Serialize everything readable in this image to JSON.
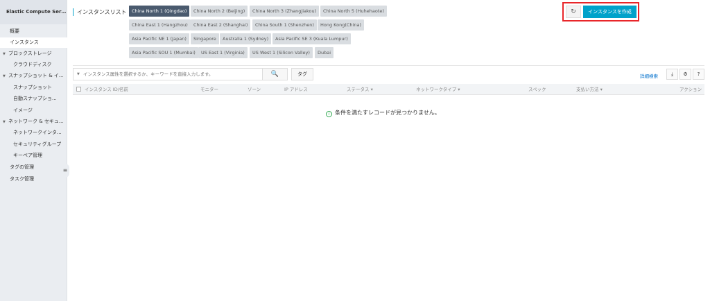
{
  "sidebar": {
    "title": "Elastic Compute Serv...",
    "items": [
      {
        "label": "概要",
        "tri": ""
      },
      {
        "label": "インスタンス",
        "tri": ""
      },
      {
        "label": "ブロックストレージ",
        "tri": "▼"
      },
      {
        "label": "クラウドディスク",
        "tri": ""
      },
      {
        "label": "スナップショット & イ...",
        "tri": "▼"
      },
      {
        "label": "スナップショット",
        "tri": ""
      },
      {
        "label": "自動スナップショ...",
        "tri": ""
      },
      {
        "label": "イメージ",
        "tri": ""
      },
      {
        "label": "ネットワーク & セキュ...",
        "tri": "▼"
      },
      {
        "label": "ネットワークインタ...",
        "tri": ""
      },
      {
        "label": "セキュリティグループ",
        "tri": ""
      },
      {
        "label": "キーペア管理",
        "tri": ""
      },
      {
        "label": "タグの管理",
        "tri": ""
      },
      {
        "label": "タスク管理",
        "tri": ""
      }
    ],
    "collapse_icon": "≡"
  },
  "header": {
    "list_title": "インスタンスリスト",
    "refresh_icon": "↻",
    "create_label": "インスタンスを作成"
  },
  "regions": [
    "China North 1 (Qingdao)",
    "China North 2 (Beijing)",
    "China North 3 (Zhangjiakou)",
    "China North 5 (Huhehaote)",
    "China East 1 (Hangzhou)",
    "China East 2 (Shanghai)",
    "China South 1 (Shenzhen)",
    "Hong Kong(China)",
    "Asia Pacific NE 1 (Japan)",
    "Singapore",
    "Australia 1 (Sydney)",
    "Asia Pacific SE 3 (Kuala Lumpur)",
    "Asia Pacific SOU 1 (Mumbai)",
    "US East 1 (Virginia)",
    "US West 1 (Silicon Valley)",
    "Dubai"
  ],
  "active_region": "China North 1 (Qingdao)",
  "search": {
    "placeholder": "インスタンス属性を選択するか、キーワードを直接入力します。",
    "caret": "▼",
    "search_icon": "🔍",
    "tag_label": "タグ"
  },
  "toolbar": {
    "advanced_search": "詳細検索",
    "export_icon": "⤓",
    "settings_icon": "⚙",
    "help_icon": "?"
  },
  "table": {
    "columns": [
      "インスタンス ID/名前",
      "モニター",
      "ゾーン",
      "IP アドレス",
      "ステータス ▾",
      "ネットワークタイプ ▾",
      "スペック",
      "支払い方法 ▾",
      "アクション"
    ]
  },
  "empty_message": "条件を満たすレコードが見つかりません。",
  "colors": {
    "accent": "#00a2ca",
    "highlight": "#e8262a",
    "active_region": "#4a5a6e"
  }
}
